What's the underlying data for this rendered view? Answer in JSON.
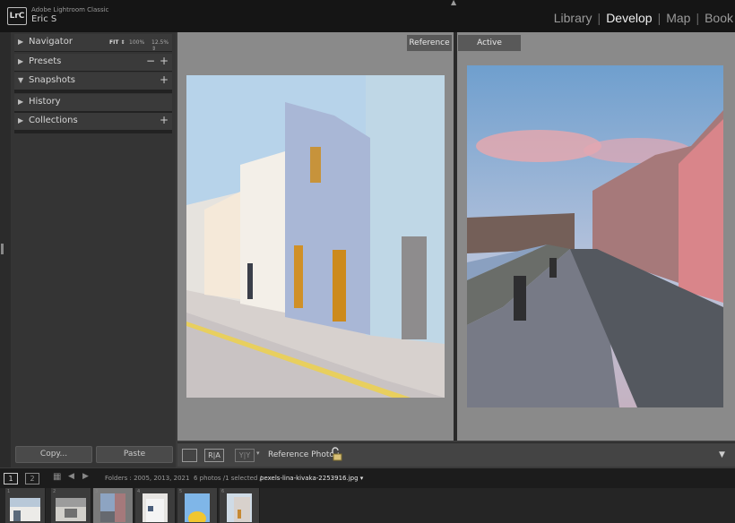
{
  "app": {
    "logo": "LrC",
    "name": "Adobe Lightroom Classic",
    "user": "Eric S",
    "modules": [
      "Library",
      "Develop",
      "Map",
      "Book"
    ],
    "active_module": "Develop"
  },
  "left_panel": {
    "navigator": {
      "label": "Navigator",
      "fit": "FIT ⇕",
      "p100": "100%",
      "p125": "12.5% ⇕"
    },
    "presets": {
      "label": "Presets"
    },
    "snapshots": {
      "label": "Snapshots"
    },
    "history": {
      "label": "History"
    },
    "collections": {
      "label": "Collections"
    },
    "copy_label": "Copy...",
    "paste_label": "Paste"
  },
  "view": {
    "reference_label": "Reference",
    "active_label": "Active",
    "reference_photo_label": "Reference Photo :"
  },
  "toolbar": {
    "ra_label": "R|A",
    "yy_label": "Y|Y"
  },
  "filmstrip": {
    "page1": "1",
    "page2": "2",
    "path": "Folders : 2005, 2013, 2021",
    "count": "6 photos /1 selected /",
    "filename": "pexels-lina-kivaka-2253916.jpg ▾",
    "thumbs": [
      {
        "num": "1",
        "selected": false
      },
      {
        "num": "2",
        "selected": false
      },
      {
        "num": "3",
        "selected": true
      },
      {
        "num": "4",
        "selected": false
      },
      {
        "num": "5",
        "selected": false
      },
      {
        "num": "6",
        "selected": false
      }
    ]
  },
  "colors": {
    "background": "#3b3b3b",
    "panel": "#343434",
    "compare_bg": "#8a8a8a",
    "active_text": "#f0f0f0"
  }
}
